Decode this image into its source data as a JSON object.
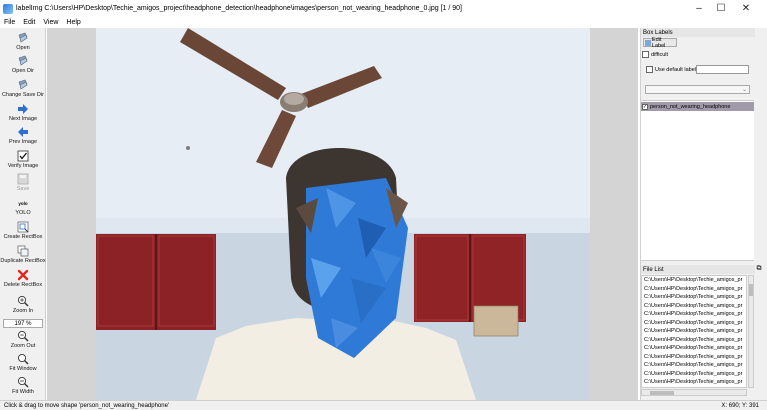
{
  "window": {
    "title": "labelImg C:\\Users\\HP\\Desktop\\Techie_amigos_project\\headphone_detection\\headphone\\images\\person_not_wearing_headphone_0.jpg [1 / 90]",
    "minimize_glyph": "–",
    "maximize_glyph": "☐",
    "close_glyph": "✕"
  },
  "menu": [
    "File",
    "Edit",
    "View",
    "Help"
  ],
  "toolbar": {
    "open": "Open",
    "open_dir": "Open Dir",
    "change_save_dir": "Change Save Dir",
    "next_image": "Next Image",
    "prev_image": "Prev Image",
    "verify_image": "Verify Image",
    "save": "Save",
    "format_icon_text": "yolo",
    "format": "YOLO",
    "create_rectbox": "Create RectBox",
    "duplicate_rectbox": "Duplicate RectBox",
    "delete_rectbox": "Delete RectBox",
    "zoom_in": "Zoom In",
    "zoom_value": "197 %",
    "zoom_out": "Zoom Out",
    "fit_window": "Fit Window",
    "fit_width": "Fit Width"
  },
  "box_labels": {
    "title": "Box Labels",
    "edit_label": "Edit Label",
    "difficult": "difficult",
    "use_default_label": "Use default label",
    "default_label_value": "",
    "label_items": [
      "person_not_wearing_headphone"
    ]
  },
  "file_list": {
    "title": "File List",
    "items": [
      "C:\\Users\\HP\\Desktop\\Techie_amigos_pr",
      "C:\\Users\\HP\\Desktop\\Techie_amigos_pr",
      "C:\\Users\\HP\\Desktop\\Techie_amigos_pr",
      "C:\\Users\\HP\\Desktop\\Techie_amigos_pr",
      "C:\\Users\\HP\\Desktop\\Techie_amigos_pr",
      "C:\\Users\\HP\\Desktop\\Techie_amigos_pr",
      "C:\\Users\\HP\\Desktop\\Techie_amigos_pr",
      "C:\\Users\\HP\\Desktop\\Techie_amigos_pr",
      "C:\\Users\\HP\\Desktop\\Techie_amigos_pr",
      "C:\\Users\\HP\\Desktop\\Techie_amigos_pr",
      "C:\\Users\\HP\\Desktop\\Techie_amigos_pr",
      "C:\\Users\\HP\\Desktop\\Techie_amigos_pr",
      "C:\\Users\\HP\\Desktop\\Techie_amigos_pr"
    ]
  },
  "status": {
    "message": "Click & drag to move shape 'person_not_wearing_headphone'",
    "coords": "X: 690; Y: 391"
  },
  "colors": {
    "selected_label_bg": "#a09aab",
    "canvas_bg": "#d4d4d4",
    "pixelation_blue": "#2f7ad6"
  }
}
